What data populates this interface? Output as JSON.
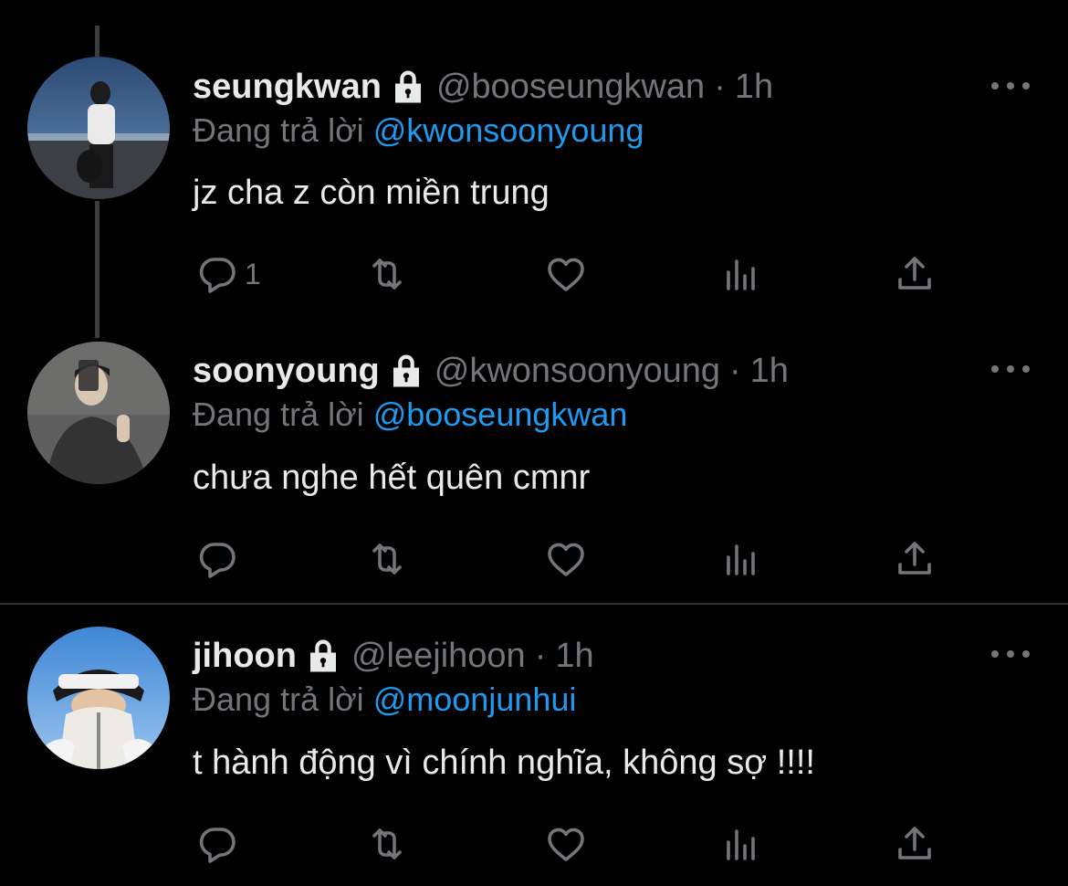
{
  "tweets": [
    {
      "name": "seungkwan",
      "handle": "@booseungkwan",
      "separator": "·",
      "time": "1h",
      "replying_label": "Đang trả lời",
      "replying_to": "@kwonsoonyoung",
      "text": "jz cha z còn miền trung",
      "reply_count": "1",
      "avatar_desc": "avatar"
    },
    {
      "name": "soonyoung",
      "handle": "@kwonsoonyoung",
      "separator": "·",
      "time": "1h",
      "replying_label": "Đang trả lời",
      "replying_to": "@booseungkwan",
      "text": "chưa nghe hết quên cmnr",
      "reply_count": "",
      "avatar_desc": "avatar"
    },
    {
      "name": "jihoon",
      "handle": "@leejihoon",
      "separator": "·",
      "time": "1h",
      "replying_label": "Đang trả lời",
      "replying_to": "@moonjunhui",
      "text": "t hành động vì chính nghĩa, không sợ !!!!",
      "reply_count": "",
      "avatar_desc": "avatar"
    }
  ],
  "icons": {
    "lock": "lock-icon",
    "more": "more-icon",
    "reply": "reply-icon",
    "retweet": "retweet-icon",
    "like": "like-icon",
    "analytics": "analytics-icon",
    "share": "share-icon"
  },
  "colors": {
    "background": "#000000",
    "text": "#e7e9ea",
    "secondary": "#71767b",
    "mention": "#1d9bf0",
    "divider": "#2f3336",
    "thread_line": "#3a3d40"
  }
}
